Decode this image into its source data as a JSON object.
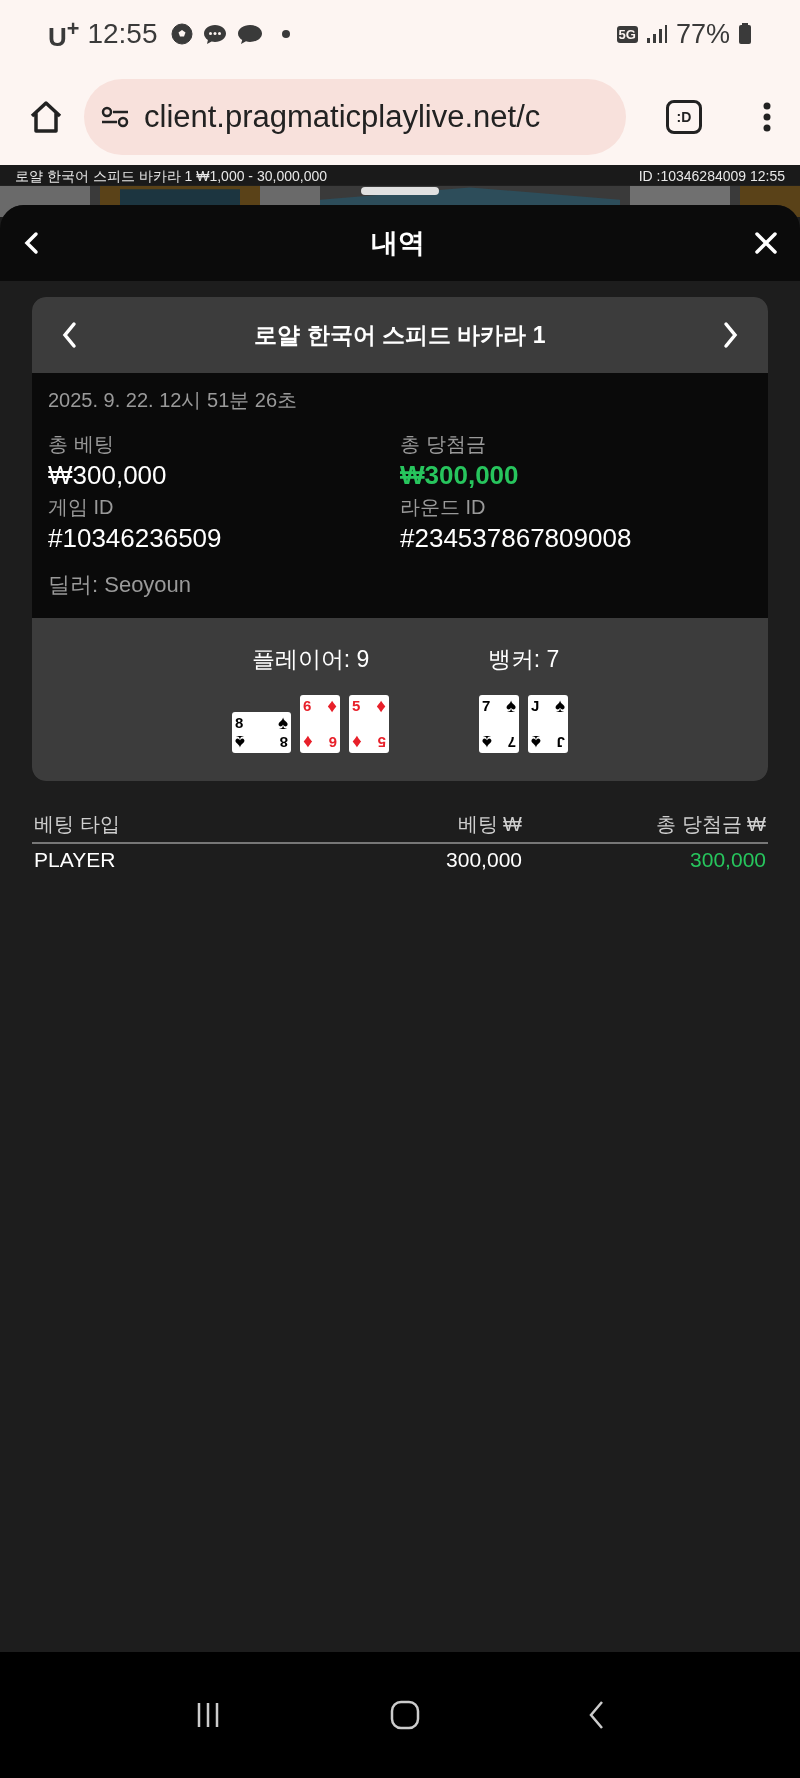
{
  "status_bar": {
    "carrier": "U$^{+}$",
    "time": "12:55",
    "network": "5G",
    "battery": "77%"
  },
  "browser": {
    "url": "client.pragmaticplaylive.net/c",
    "tabs": ":D"
  },
  "game_strip": {
    "info": "로얄 한국어 스피드 바카라 1 ₩1,000 - 30,000,000",
    "id": "ID :10346284009 12:55"
  },
  "sheet": {
    "title": "내역"
  },
  "round": {
    "title": "로얄 한국어 스피드 바카라 1",
    "datetime": "2025. 9. 22. 12시 51분 26초",
    "fields": [
      {
        "label": "총 베팅",
        "value": "₩300,000",
        "win": false
      },
      {
        "label": "총 당첨금",
        "value": "₩300,000",
        "win": true
      },
      {
        "label": "게임 ID",
        "value": "#10346236509",
        "win": false
      },
      {
        "label": "라운드 ID",
        "value": "#234537867809008",
        "win": false
      }
    ],
    "dealer": "딜러: Seoyoun",
    "hands": [
      {
        "label": "플레이어: 9",
        "cards": [
          {
            "top_rank": "8",
            "top_suit": "♠",
            "bottom_suit": "♠",
            "bottom_rank": "8",
            "red": false,
            "sideways": true
          },
          {
            "top_rank": "6",
            "top_suit": "♦",
            "bottom_suit": "♦",
            "bottom_rank": "6",
            "red": true,
            "sideways": false
          },
          {
            "top_rank": "5",
            "top_suit": "♦",
            "bottom_suit": "♦",
            "bottom_rank": "5",
            "red": true,
            "sideways": false
          }
        ]
      },
      {
        "label": "뱅커: 7",
        "cards": [
          {
            "top_rank": "7",
            "top_suit": "♠",
            "bottom_suit": "♠",
            "bottom_rank": "7",
            "red": false,
            "sideways": false
          },
          {
            "top_rank": "J",
            "top_suit": "♠",
            "bottom_suit": "♠",
            "bottom_rank": "J",
            "red": false,
            "sideways": false
          }
        ]
      }
    ]
  },
  "bets": {
    "columns": [
      "베팅 타입",
      "베팅 ₩",
      "총 당첨금 ₩"
    ],
    "rows": [
      {
        "type": "PLAYER",
        "bet": "300,000",
        "win": "300,000"
      }
    ]
  }
}
